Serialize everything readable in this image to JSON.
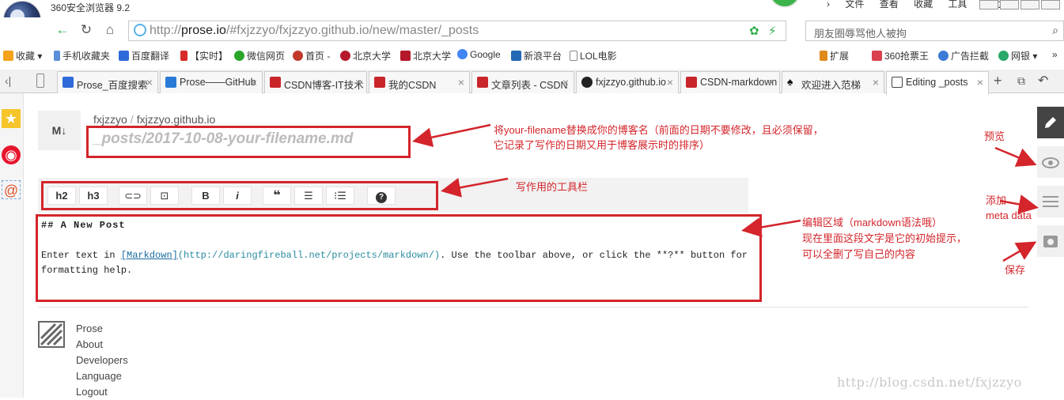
{
  "browser": {
    "title": "360安全浏览器 9.2",
    "menus": [
      "文件",
      "查看",
      "收藏",
      "工具",
      "帮助"
    ],
    "url_prefix": "http://",
    "url_host": "prose.io",
    "url_path": "/#fxjzzyo/fxjzzyo.github.io/new/master/_posts",
    "search_text": "朋友圈辱骂他人被拘"
  },
  "bookmarks": [
    {
      "label": "收藏",
      "color": "#f3a21a"
    },
    {
      "label": "手机收藏夹",
      "color": "#5b8fd9"
    },
    {
      "label": "百度翻译",
      "color": "#2f6bd8"
    },
    {
      "label": "【实时】",
      "color": "#d92a2a"
    },
    {
      "label": "微信网页",
      "color": "#2aa52a"
    },
    {
      "label": "首页 -",
      "color": "#c0392b"
    },
    {
      "label": "北京大学",
      "color": "#b5182b"
    },
    {
      "label": "北京大学",
      "color": "#b5182b"
    },
    {
      "label": "Google",
      "color": "#4285f4"
    },
    {
      "label": "新浪平台",
      "color": "#2268b5"
    },
    {
      "label": "LOL电影",
      "color": "#888888"
    }
  ],
  "bookmarks_right": [
    "扩展",
    "360抢票王",
    "广告拦截",
    "网银"
  ],
  "tabs": [
    {
      "label": "Prose_百度搜索",
      "color": "#2f6bd8"
    },
    {
      "label": "Prose——GitHub",
      "color": "#2a7bd8"
    },
    {
      "label": "CSDN博客-IT技术",
      "color": "#c9252b"
    },
    {
      "label": "我的CSDN",
      "color": "#c9252b"
    },
    {
      "label": "文章列表 - CSDN",
      "color": "#c9252b"
    },
    {
      "label": "fxjzzyo.github.io",
      "color": "#222222"
    },
    {
      "label": "CSDN-markdown",
      "color": "#c9252b"
    },
    {
      "label": "欢迎进入范梯",
      "color": "#111111"
    },
    {
      "label": "Editing _posts",
      "color": "#444444"
    }
  ],
  "prose": {
    "md_badge": "M↓",
    "owner": "fxjzzyo",
    "repo": "fxjzzyo.github.io",
    "filename_placeholder": "_posts/2017-10-08-your-filename.md",
    "toolbar": [
      "h2",
      "h3",
      "link",
      "image",
      "B",
      "i",
      "quote",
      "ul",
      "ol",
      "help"
    ],
    "editor": {
      "line1": "## A New Post",
      "line3_a": "Enter text in ",
      "line3_link": "[Markdown]",
      "line3_url": "(http://daringfireball.net/projects/markdown/)",
      "line3_b": ". Use the toolbar above, or click the **?** button for",
      "line4": "formatting help."
    },
    "footer": [
      "Prose",
      "About",
      "Developers",
      "Language",
      "Logout"
    ]
  },
  "annotations": {
    "filename_note_1": "将your-filename替换成你的博客名（前面的日期不要修改，且必须保留，",
    "filename_note_2": "它记录了写作的日期又用于博客展示时的排序）",
    "toolbar_note": "写作用的工具栏",
    "editor_note_1": "编辑区域（markdown语法哦）",
    "editor_note_2": "现在里面这段文字是它的初始提示，",
    "editor_note_3": "可以全删了写自己的内容",
    "preview_note": "预览",
    "meta_note_1": "添加",
    "meta_note_2": "meta data",
    "save_note": "保存"
  },
  "watermark": "http://blog.csdn.net/fxjzzyo",
  "colors": {
    "annotation_red": "#d3252b",
    "url_green": "#2fae4a"
  }
}
